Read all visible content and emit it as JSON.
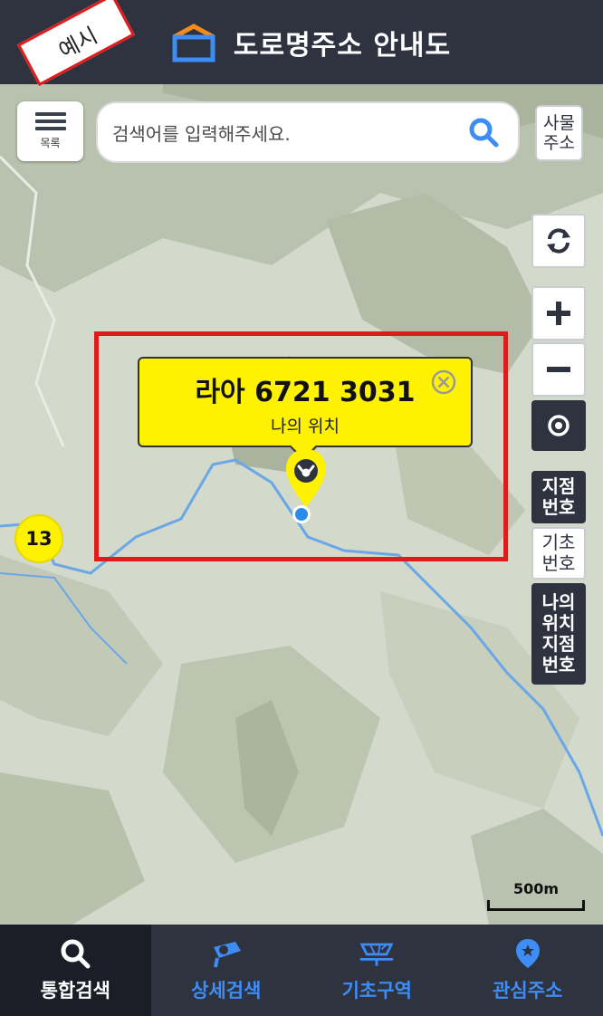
{
  "header": {
    "title": "도로명주소 안내도",
    "example_tag": "예시"
  },
  "search": {
    "menu_label": "목록",
    "placeholder": "검색어를 입력해주세요.",
    "building_label_line1": "사물",
    "building_label_line2": "주소"
  },
  "map": {
    "popup_code": "라아 6721 3031",
    "popup_subtitle": "나의 위치",
    "cluster_count": "13",
    "scale_label": "500m"
  },
  "side_buttons": {
    "point_number": [
      "지점",
      "번호"
    ],
    "base_number": [
      "기초",
      "번호"
    ],
    "my_point_number": [
      "나의",
      "위치",
      "지점",
      "번호"
    ]
  },
  "bottom_nav": [
    {
      "label": "통합검색",
      "icon": "search-icon",
      "active": true
    },
    {
      "label": "상세검색",
      "icon": "detail-search-icon",
      "active": false
    },
    {
      "label": "기초구역",
      "icon": "base-area-icon",
      "active": false
    },
    {
      "label": "관심주소",
      "icon": "favorite-pin-icon",
      "active": false
    }
  ],
  "colors": {
    "header_bg": "#2f3340",
    "highlight": "#e01b1b",
    "popup_bg": "#fff200",
    "accent_blue": "#3d8df5"
  }
}
